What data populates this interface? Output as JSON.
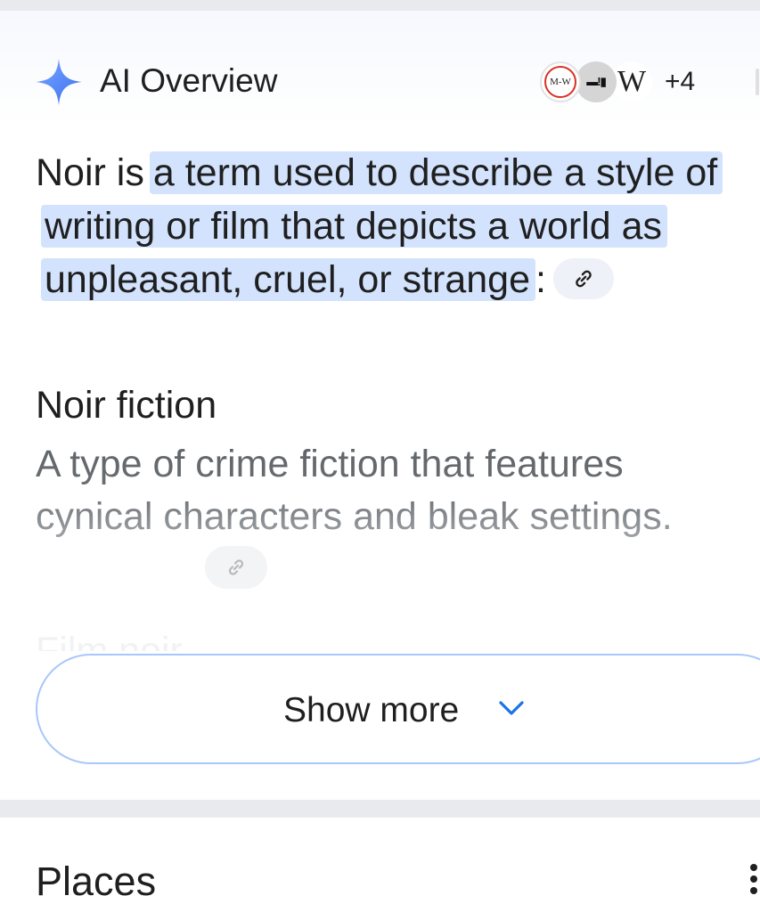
{
  "ai_overview": {
    "title": "AI Overview",
    "sources": [
      {
        "name": "M-W",
        "icon": "merriam-webster-logo"
      },
      {
        "name": "film-reel",
        "icon": "film-site-logo"
      },
      {
        "name": "W",
        "icon": "wikipedia-logo"
      }
    ],
    "more_sources": "+4",
    "summary_prefix": "Noir is",
    "summary_highlight": "a term used to describe a style of writing or film that depicts a world as unpleasant, cruel, or strange",
    "summary_suffix": ":",
    "section_heading": "Noir fiction",
    "section_body": "A type of crime fiction that features cynical characters and bleak settings.",
    "next_heading_faded": "Film noir",
    "show_more_label": "Show more"
  },
  "places": {
    "title": "Places"
  },
  "colors": {
    "highlight": "#d3e3fd",
    "accent": "#1a73e8",
    "sparkle": "#4f86f7",
    "button_border": "#a8c7fa"
  }
}
